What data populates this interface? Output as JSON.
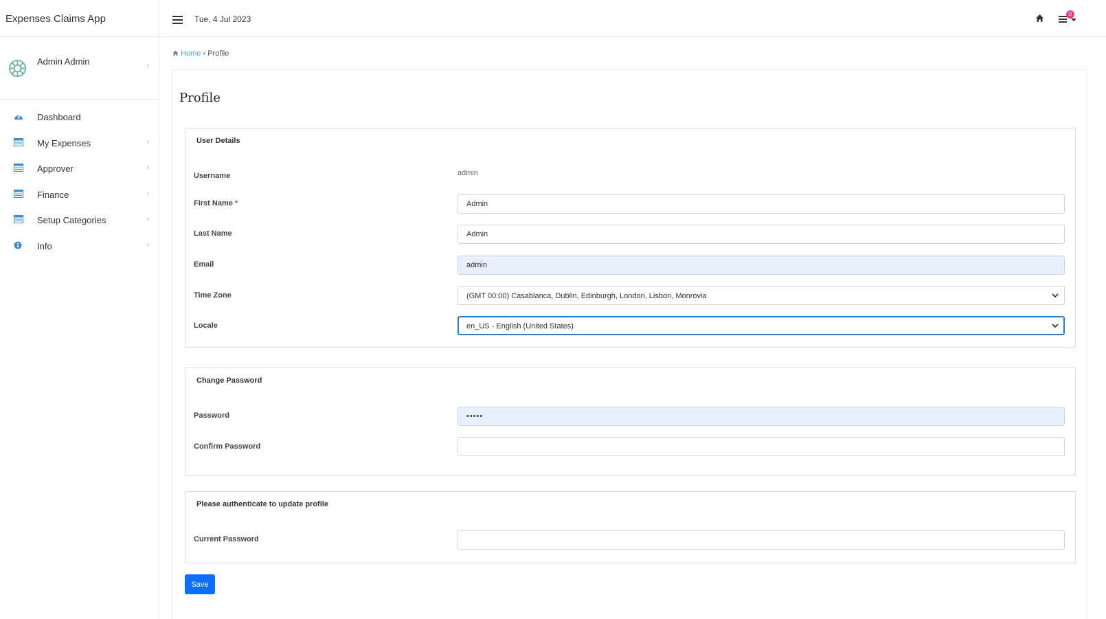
{
  "app": {
    "title": "Expenses Claims App"
  },
  "user": {
    "name": "Admin Admin"
  },
  "sidebar": {
    "items": [
      {
        "label": "Dashboard",
        "icon": "dashboard-icon"
      },
      {
        "label": "My Expenses",
        "icon": "table-icon"
      },
      {
        "label": "Approver",
        "icon": "table-icon"
      },
      {
        "label": "Finance",
        "icon": "table-icon"
      },
      {
        "label": "Setup Categories",
        "icon": "table-icon"
      },
      {
        "label": "Info",
        "icon": "info-icon"
      }
    ]
  },
  "topbar": {
    "date": "Tue, 4 Jul 2023",
    "notification_count": "0"
  },
  "breadcrumb": {
    "home": "Home",
    "separator": "›",
    "current": "Profile"
  },
  "page": {
    "title": "Profile"
  },
  "user_details": {
    "title": "User Details",
    "username_label": "Username",
    "username_value": "admin",
    "first_name_label": "First Name",
    "required_mark": "*",
    "first_name_value": "Admin",
    "last_name_label": "Last Name",
    "last_name_value": "Admin",
    "email_label": "Email",
    "email_value": "admin",
    "timezone_label": "Time Zone",
    "timezone_value": "(GMT 00:00) Casablanca, Dublin, Edinburgh, London, Lisbon, Monrovia",
    "locale_label": "Locale",
    "locale_value": "en_US - English (United States)"
  },
  "change_password": {
    "title": "Change Password",
    "password_label": "Password",
    "password_value": "•••••",
    "confirm_label": "Confirm Password"
  },
  "authenticate": {
    "title": "Please authenticate to update profile",
    "current_label": "Current Password"
  },
  "actions": {
    "save_label": "Save"
  },
  "colors": {
    "accent": "#0d6efd",
    "link": "#4aa3df",
    "icon": "#3b8fd0",
    "badge": "#e83e8c",
    "autofill": "#e8f0fe"
  }
}
